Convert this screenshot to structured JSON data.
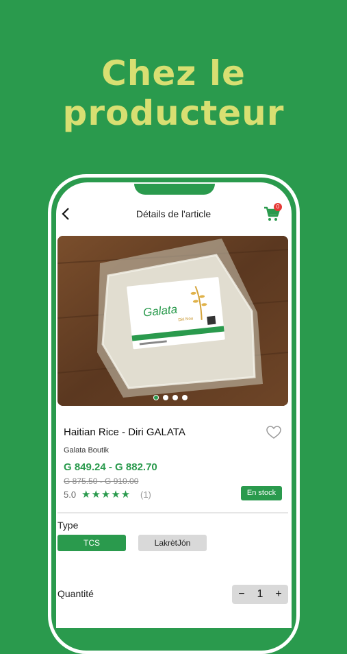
{
  "promo": {
    "headline_line1": "Chez le",
    "headline_line2": "producteur"
  },
  "topbar": {
    "title": "Détails de l'article",
    "cart_count": "0"
  },
  "product": {
    "image_label": "Galata",
    "image_sub": "Diri Nou",
    "title": "Haitian Rice - Diri GALATA",
    "seller": "Galata Boutik",
    "price": "G 849.24 - G 882.70",
    "old_price": "G 875.50 - G 910.00",
    "rating": "5.0",
    "stars": "★★★★★",
    "rating_count": "(1)",
    "stock": "En stock",
    "carousel_dots": 4,
    "carousel_active": 0
  },
  "type_section": {
    "label": "Type",
    "options": [
      "TCS",
      "LakrètJón"
    ],
    "selected": "TCS"
  },
  "quantity": {
    "label": "Quantité",
    "minus": "−",
    "value": "1",
    "plus": "+"
  },
  "colors": {
    "brand_green": "#2a9a4d",
    "headline_yellow": "#d8df72",
    "badge_red": "#e53935"
  }
}
